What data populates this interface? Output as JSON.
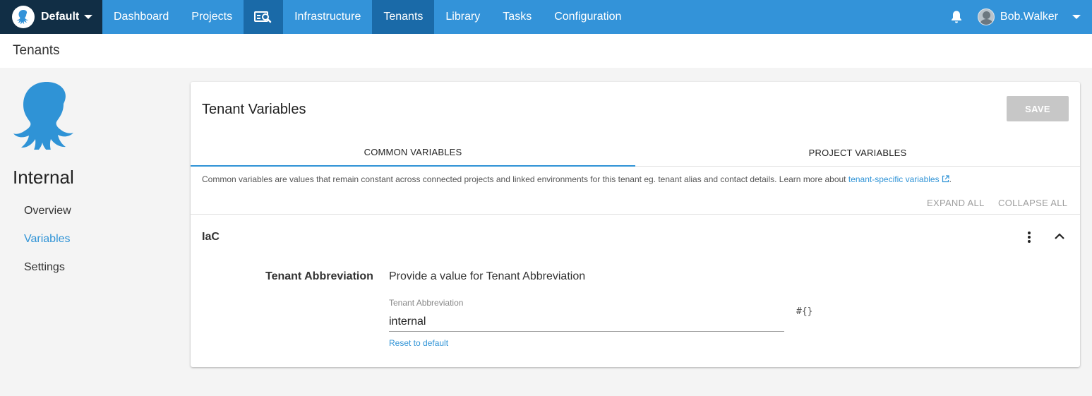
{
  "nav": {
    "space": "Default",
    "links": {
      "dashboard": "Dashboard",
      "projects": "Projects",
      "infrastructure": "Infrastructure",
      "tenants": "Tenants",
      "library": "Library",
      "tasks": "Tasks",
      "configuration": "Configuration"
    },
    "user": "Bob.Walker"
  },
  "page": {
    "title": "Tenants"
  },
  "sidebar": {
    "tenant_name": "Internal",
    "items": [
      "Overview",
      "Variables",
      "Settings"
    ],
    "active_item": "Variables"
  },
  "card": {
    "title": "Tenant Variables",
    "save_label": "SAVE",
    "tabs": [
      "COMMON VARIABLES",
      "PROJECT VARIABLES"
    ],
    "active_tab": "COMMON VARIABLES",
    "description": "Common variables are values that remain constant across connected projects and linked environments for this tenant eg. tenant alias and contact details. Learn more about ",
    "description_link": "tenant-specific variables",
    "description_end": ".",
    "expand_all": "EXPAND ALL",
    "collapse_all": "COLLAPSE ALL",
    "group": {
      "title": "IaC",
      "variable_label": "Tenant Abbreviation",
      "variable_help": "Provide a value for Tenant Abbreviation",
      "field_label": "Tenant Abbreviation",
      "field_value": "internal",
      "binding_icon": "#{}",
      "reset_label": "Reset to default"
    }
  },
  "colors": {
    "nav_bg": "#3393d9",
    "nav_active": "#1a6aa8",
    "space_bg": "#112e45",
    "accent": "#2f93d6",
    "save_disabled": "#c7c7c7"
  },
  "icons": [
    "octopus-logo-icon",
    "search-icon",
    "bell-icon",
    "avatar",
    "chevron-down-icon",
    "external-link-icon",
    "kebab-menu-icon",
    "chevron-up-icon"
  ]
}
